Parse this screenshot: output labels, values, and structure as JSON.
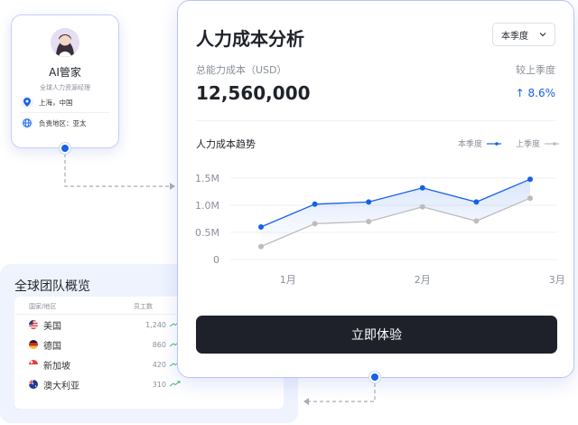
{
  "profile": {
    "name": "AI管家",
    "role": "全球人力资源经理",
    "location": "上海，中国",
    "region": "负责地区：亚太"
  },
  "team": {
    "title": "全球团队概览",
    "col_country": "国家/地区",
    "col_staff": "员工数",
    "rows": [
      {
        "country": "美国",
        "count": "1,240"
      },
      {
        "country": "德国",
        "count": "860"
      },
      {
        "country": "新加坡",
        "count": "420"
      },
      {
        "country": "澳大利亚",
        "count": "310"
      }
    ]
  },
  "card": {
    "title": "人力成本分析",
    "period": "本季度",
    "kpi_label": "总能力成本（USD）",
    "kpi_value": "12,560,000",
    "cmp_label": "较上季度",
    "cmp_value": "↑ 8.6%",
    "chart_title": "人力成本趋势",
    "cta": "立即体验"
  },
  "colors": {
    "accent": "#1662e6",
    "previous": "#bcbcbc",
    "cta": "#1e2129"
  },
  "chart_data": {
    "type": "line",
    "title": "人力成本趋势",
    "x": [
      0,
      1,
      2,
      3,
      4,
      5,
      6
    ],
    "x_tick_labels": [
      {
        "x": 0.5,
        "label": "1月"
      },
      {
        "x": 3,
        "label": "2月"
      },
      {
        "x": 5.5,
        "label": "3月"
      }
    ],
    "y_ticks": [
      "0",
      "0.5M",
      "1.0M",
      "1.5M"
    ],
    "ylim": [
      0,
      1.6
    ],
    "grid": true,
    "legend_position": "top-right",
    "series": [
      {
        "name": "本季度",
        "values": [
          0.6,
          1.02,
          1.06,
          1.32,
          1.06,
          1.48
        ]
      },
      {
        "name": "上季度",
        "values": [
          0.24,
          0.66,
          0.7,
          0.97,
          0.71,
          1.13
        ]
      }
    ]
  }
}
